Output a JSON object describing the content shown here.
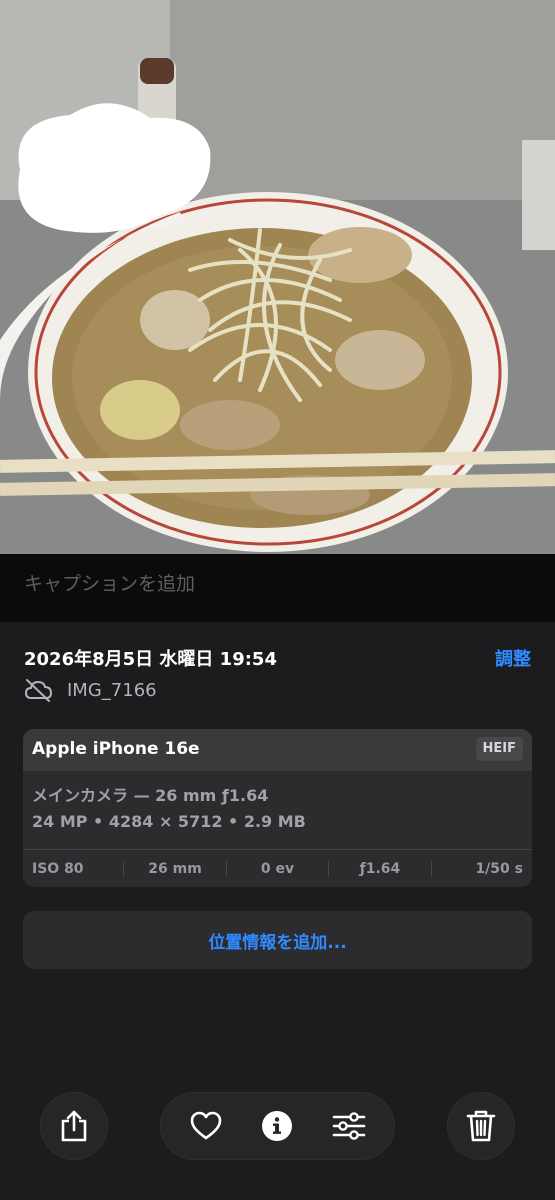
{
  "caption": {
    "placeholder": "キャプションを追加"
  },
  "info": {
    "datetime": "2026年8月5日 水曜日 19:54",
    "adjust_label": "調整",
    "filename": "IMG_7166",
    "icon": "cloud-slash-icon"
  },
  "camera": {
    "model": "Apple iPhone 16e",
    "format": "HEIF",
    "lens": "メインカメラ — 26 mm ƒ1.64",
    "specs": "24 MP • 4284 × 5712 • 2.9 MB",
    "exif": [
      "ISO 80",
      "26 mm",
      "0 ev",
      "ƒ1.64",
      "1/50 s"
    ]
  },
  "location": {
    "add_label": "位置情報を追加..."
  },
  "toolbar": {
    "icons": [
      "share-icon",
      "heart-icon",
      "info-icon",
      "sliders-icon",
      "trash-icon"
    ]
  },
  "colors": {
    "accent": "#2f8bff",
    "sheet": "#1c1c1e",
    "card": "#2c2c2e"
  }
}
